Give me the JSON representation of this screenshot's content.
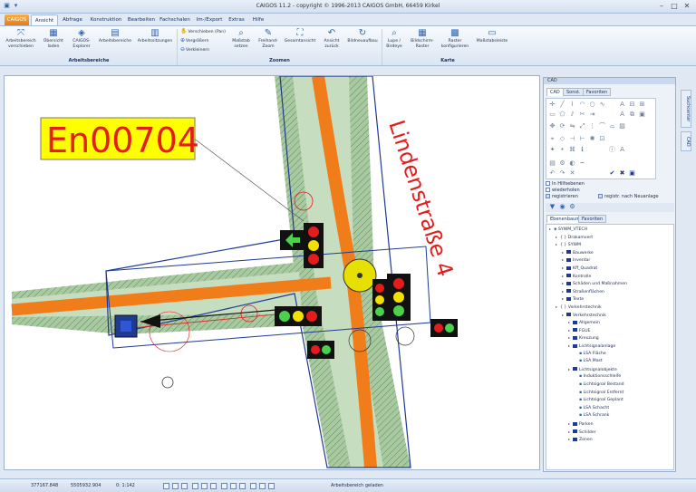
{
  "window": {
    "title": "CAIGOS 11.2   -   copyright © 1996-2013 CAIGOS GmbH, 66459 Kirkel"
  },
  "tabs": [
    {
      "label": "CAIGOS",
      "kind": "app"
    },
    {
      "label": "Ansicht",
      "kind": "active"
    },
    {
      "label": "Abfrage",
      "kind": ""
    },
    {
      "label": "Konstruktion",
      "kind": ""
    },
    {
      "label": "Bearbeiten",
      "kind": ""
    },
    {
      "label": "Fachschalen",
      "kind": ""
    },
    {
      "label": "Im-/Export",
      "kind": ""
    },
    {
      "label": "Extras",
      "kind": ""
    },
    {
      "label": "Hilfe",
      "kind": ""
    }
  ],
  "ribbon": {
    "arbeitsbereich_verschieben": "Arbeitsbereich verschieben",
    "uebersicht_laden": "Übersicht laden",
    "caigos_explorer": "CAIGOS-Explorer",
    "arbeitsbereiche": "Arbeitsbereiche",
    "arbeitssitzungen": "Arbeitssitzungen",
    "group_arbeitsbereiche": "Arbeitsbereiche",
    "verschieben_pan": "Verschieben (Pan)",
    "vergroessern": "Vergrößern",
    "verkleinern": "Verkleinern",
    "massstab_setzen": "Maßstab setzen",
    "freihand_zoom": "Freihand-Zoom",
    "gesamtansicht": "Gesamtansicht",
    "ansicht_zurueck": "Ansicht zurück",
    "bildneuaufbau": "Bildneuaufbau",
    "group_zoomen": "Zoomen",
    "lupe_birdeye": "Lupe / Birdeye",
    "bildschirm_raster": "Bildschirm-Raster",
    "raster_konfigurieren": "Raster konfigurieren",
    "massstabsleiste": "Maßstabsleiste",
    "group_karte": "Karte"
  },
  "map": {
    "label_box": "En00704",
    "street_label": "Lindenstraße 4",
    "colors": {
      "road": "#f07d1a",
      "verge": "#a9c9a0",
      "label_bg": "#ffff00",
      "label_text": "#e51c1c",
      "street_text": "#e51c1c",
      "outline": "#1f3a93"
    }
  },
  "panel": {
    "title": "CAD",
    "tabs": [
      "CAD",
      "Sonst.",
      "Favoriten"
    ],
    "checkboxes": [
      {
        "label": "In Hilfsebenen",
        "checked": false
      },
      {
        "label": "wiederholen",
        "checked": false
      },
      {
        "label": "registrieren",
        "checked": true
      },
      {
        "label": "registr. nach Neuanlage",
        "checked": true
      }
    ],
    "tree_tabs": [
      "Ebenenbaum",
      "Favoriten"
    ],
    "tree": [
      {
        "label": "SYWM_VTECH",
        "level": 0,
        "type": "root"
      },
      {
        "label": "Drakamvert",
        "level": 1,
        "type": "brace"
      },
      {
        "label": "SYWM",
        "level": 1,
        "type": "brace"
      },
      {
        "label": "Bauwerke",
        "level": 2,
        "type": "folder"
      },
      {
        "label": "Inventar",
        "level": 2,
        "type": "folder"
      },
      {
        "label": "Kff_Quadrat",
        "level": 2,
        "type": "folder"
      },
      {
        "label": "Kontrolle",
        "level": 2,
        "type": "folder"
      },
      {
        "label": "Schäden und Maßnahmen",
        "level": 2,
        "type": "folder"
      },
      {
        "label": "Straßenflächen",
        "level": 2,
        "type": "folder"
      },
      {
        "label": "Texte",
        "level": 2,
        "type": "folder"
      },
      {
        "label": "Verkehrstechnik",
        "level": 1,
        "type": "brace"
      },
      {
        "label": "Verkehrstechnik",
        "level": 2,
        "type": "folder"
      },
      {
        "label": "Allgemein",
        "level": 3,
        "type": "folder"
      },
      {
        "label": "FGUE",
        "level": 3,
        "type": "folder"
      },
      {
        "label": "Kreuzung",
        "level": 3,
        "type": "folder"
      },
      {
        "label": "Lichtsignalanlage",
        "level": 3,
        "type": "folder"
      },
      {
        "label": "LSA Fläche",
        "level": 4,
        "type": "item"
      },
      {
        "label": "LSA Mast",
        "level": 4,
        "type": "item"
      },
      {
        "label": "Lichtsignalobjekte",
        "level": 3,
        "type": "folder"
      },
      {
        "label": "Induktionsschleife",
        "level": 4,
        "type": "item"
      },
      {
        "label": "Lichtsignal Bestand",
        "level": 4,
        "type": "item"
      },
      {
        "label": "Lichtsignal Entfernt",
        "level": 4,
        "type": "item"
      },
      {
        "label": "Lichtsignal Geplant",
        "level": 4,
        "type": "item"
      },
      {
        "label": "LSA Schacht",
        "level": 4,
        "type": "item"
      },
      {
        "label": "LSA Schrank",
        "level": 4,
        "type": "item"
      },
      {
        "label": "Parken",
        "level": 3,
        "type": "folder"
      },
      {
        "label": "Schilder",
        "level": 3,
        "type": "folder"
      },
      {
        "label": "Zonen",
        "level": 3,
        "type": "folder"
      }
    ]
  },
  "sidetabs": [
    "Suchcenter",
    "CAD"
  ],
  "status": {
    "x": "377167.848",
    "y": "5505932.904",
    "scale": "0: 1:142",
    "message": "Arbeitsbereich geladen"
  }
}
